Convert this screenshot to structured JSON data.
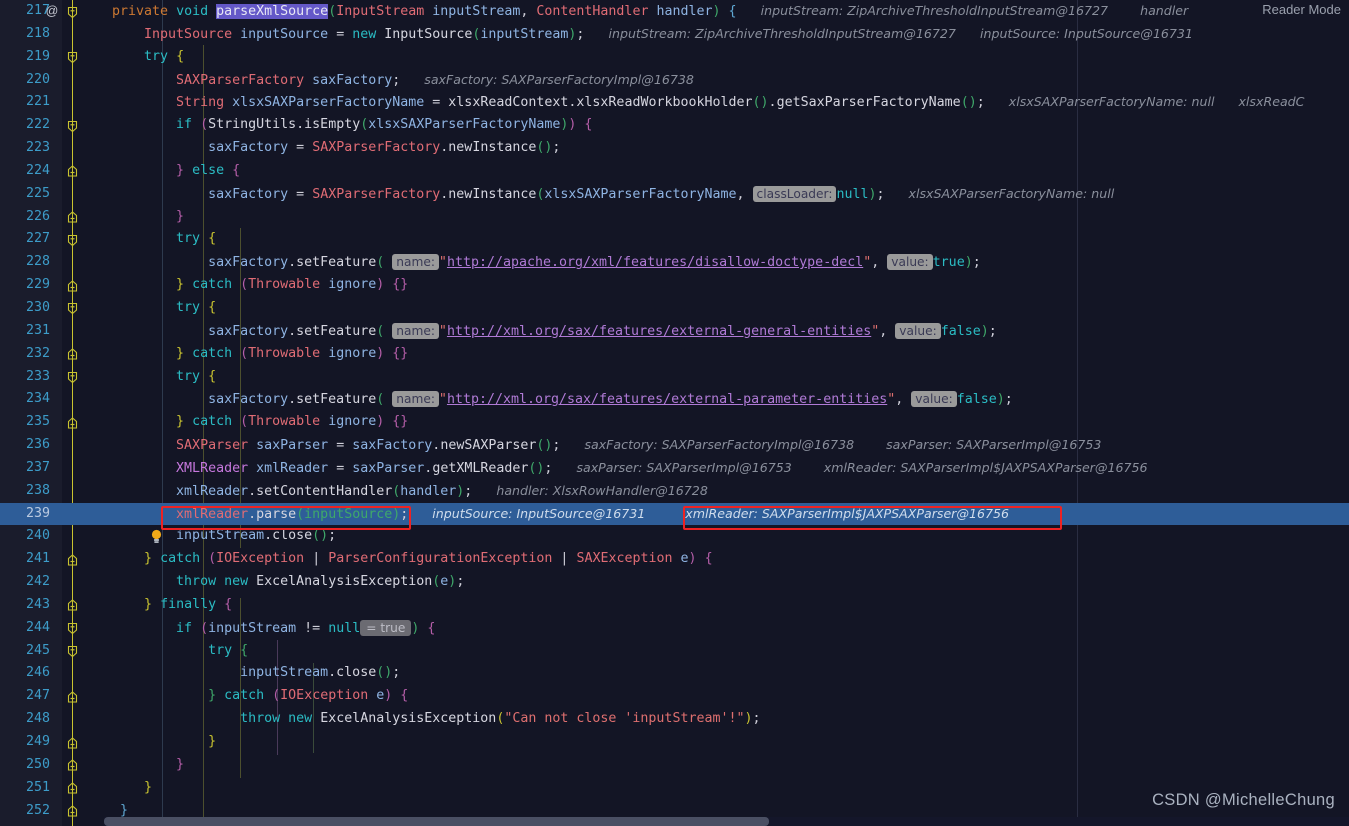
{
  "app": {
    "name": "IntelliJ IDEA Editor",
    "reader_mode_label": "Reader Mode",
    "watermark": "CSDN @MichelleChung",
    "theme": "dark",
    "colors": {
      "background": "#131525",
      "gutter": "#1a1c2c",
      "selected_line": "#2e5d98",
      "line_number": "#3d9cc9",
      "fold_spine": "#c9c330",
      "annotation_box": "#ee2222",
      "hint_chip_bg": "#9a9a9a",
      "debug_hint": "#8a8f9c"
    }
  },
  "gutter": {
    "annotation_marker": "@",
    "bulb_line": 239
  },
  "editor": {
    "first_line": 217,
    "last_line": 252,
    "selected_line": 239,
    "highlighted_identifier": "parseXmlSource"
  },
  "lines": [
    {
      "n": "217",
      "at": "@",
      "fold": "start"
    },
    {
      "n": "218"
    },
    {
      "n": "219",
      "fold": "start"
    },
    {
      "n": "220"
    },
    {
      "n": "221"
    },
    {
      "n": "222",
      "fold": "start"
    },
    {
      "n": "223"
    },
    {
      "n": "224",
      "fold": "mid"
    },
    {
      "n": "225"
    },
    {
      "n": "226",
      "fold": "mid"
    },
    {
      "n": "227",
      "fold": "start"
    },
    {
      "n": "228"
    },
    {
      "n": "229",
      "fold": "mid"
    },
    {
      "n": "230",
      "fold": "start"
    },
    {
      "n": "231"
    },
    {
      "n": "232",
      "fold": "mid"
    },
    {
      "n": "233",
      "fold": "start"
    },
    {
      "n": "234"
    },
    {
      "n": "235",
      "fold": "mid"
    },
    {
      "n": "236"
    },
    {
      "n": "237"
    },
    {
      "n": "238"
    },
    {
      "n": "239",
      "bulb": true,
      "selected": true
    },
    {
      "n": "240"
    },
    {
      "n": "241",
      "fold": "start"
    },
    {
      "n": "242"
    },
    {
      "n": "243",
      "fold": "mid"
    },
    {
      "n": "244",
      "fold": "start"
    },
    {
      "n": "245",
      "fold": "start"
    },
    {
      "n": "246"
    },
    {
      "n": "247",
      "fold": "mid"
    },
    {
      "n": "248"
    },
    {
      "n": "249",
      "fold": "mid"
    },
    {
      "n": "250",
      "fold": "mid"
    },
    {
      "n": "251",
      "fold": "mid"
    },
    {
      "n": "252",
      "fold": "mid"
    }
  ],
  "code_text": {
    "l217": "    private void parseXmlSource(InputStream inputStream, ContentHandler handler) {",
    "l218": "        InputSource inputSource = new InputSource(inputStream);",
    "l219": "        try {",
    "l220": "            SAXParserFactory saxFactory;",
    "l221": "            String xlsxSAXParserFactoryName = xlsxReadContext.xlsxReadWorkbookHolder().getSaxParserFactoryName();",
    "l222": "            if (StringUtils.isEmpty(xlsxSAXParserFactoryName)) {",
    "l223": "                saxFactory = SAXParserFactory.newInstance();",
    "l224": "            } else {",
    "l225": "                saxFactory = SAXParserFactory.newInstance(xlsxSAXParserFactoryName, null);",
    "l226": "            }",
    "l227": "            try {",
    "l228": "                saxFactory.setFeature(\"http://apache.org/xml/features/disallow-doctype-decl\", true);",
    "l229": "            } catch (Throwable ignore) {}",
    "l230": "            try {",
    "l231": "                saxFactory.setFeature(\"http://xml.org/sax/features/external-general-entities\", false);",
    "l232": "            } catch (Throwable ignore) {}",
    "l233": "            try {",
    "l234": "                saxFactory.setFeature(\"http://xml.org/sax/features/external-parameter-entities\", false);",
    "l235": "            } catch (Throwable ignore) {}",
    "l236": "            SAXParser saxParser = saxFactory.newSAXParser();",
    "l237": "            XMLReader xmlReader = saxParser.getXMLReader();",
    "l238": "            xmlReader.setContentHandler(handler);",
    "l239": "            xmlReader.parse(inputSource);",
    "l240": "            inputStream.close();",
    "l241": "        } catch (IOException | ParserConfigurationException | SAXException e) {",
    "l242": "            throw new ExcelAnalysisException(e);",
    "l243": "        } finally {",
    "l244": "            if (inputStream != null) {",
    "l245": "                try {",
    "l246": "                    inputStream.close();",
    "l247": "                } catch (IOException e) {",
    "l248": "                    throw new ExcelAnalysisException(\"Can not close 'inputStream'!\");",
    "l249": "                }",
    "l250": "            }",
    "l251": "        }",
    "l252": "    }"
  },
  "parameter_hints": {
    "name": "name:",
    "value": "value:",
    "class_loader": "classLoader:",
    "eval_true": "= true"
  },
  "debug_hints": {
    "l217_a": "inputStream: ZipArchiveThresholdInputStream@16727",
    "l217_b": "handler",
    "l218_a": "inputStream: ZipArchiveThresholdInputStream@16727",
    "l218_b": "inputSource: InputSource@16731",
    "l220": "saxFactory: SAXParserFactoryImpl@16738",
    "l221_a": "xlsxSAXParserFactoryName: null",
    "l221_b": "xlsxReadC",
    "l225": "xlsxSAXParserFactoryName: null",
    "l236_a": "saxFactory: SAXParserFactoryImpl@16738",
    "l236_b": "saxParser: SAXParserImpl@16753",
    "l237_a": "saxParser: SAXParserImpl@16753",
    "l237_b": "xmlReader: SAXParserImpl$JAXPSAXParser@16756",
    "l238": "handler: XlsxRowHandler@16728",
    "l239_a": "inputSource: InputSource@16731",
    "l239_b": "xmlReader: SAXParserImpl$JAXPSAXParser@16756"
  },
  "annotations": {
    "box1_target": "xmlReader.parse(inputSource);",
    "box2_target": "xmlReader: SAXParserImpl$JAXPSAXParser@16756"
  },
  "scrollbar": {
    "orientation": "horizontal",
    "thumb_fraction": "0.53"
  }
}
